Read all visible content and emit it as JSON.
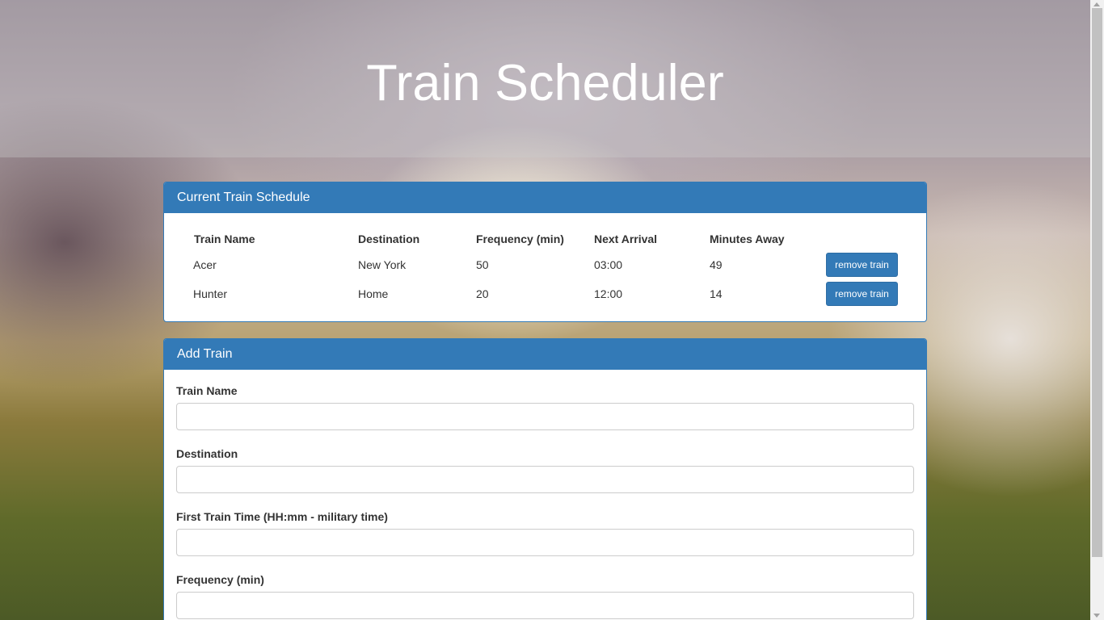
{
  "header": {
    "title": "Train Scheduler"
  },
  "schedule": {
    "heading": "Current Train Schedule",
    "columns": [
      "Train Name",
      "Destination",
      "Frequency (min)",
      "Next Arrival",
      "Minutes Away"
    ],
    "rows": [
      {
        "name": "Acer",
        "destination": "New York",
        "frequency": "50",
        "next_arrival": "03:00",
        "minutes_away": "49",
        "action": "remove train"
      },
      {
        "name": "Hunter",
        "destination": "Home",
        "frequency": "20",
        "next_arrival": "12:00",
        "minutes_away": "14",
        "action": "remove train"
      }
    ]
  },
  "add_train": {
    "heading": "Add Train",
    "fields": [
      {
        "label": "Train Name",
        "value": ""
      },
      {
        "label": "Destination",
        "value": ""
      },
      {
        "label": "First Train Time (HH:mm - military time)",
        "value": ""
      },
      {
        "label": "Frequency (min)",
        "value": ""
      }
    ]
  },
  "colors": {
    "panel_primary": "#337ab7",
    "title_text": "#ffffff"
  }
}
